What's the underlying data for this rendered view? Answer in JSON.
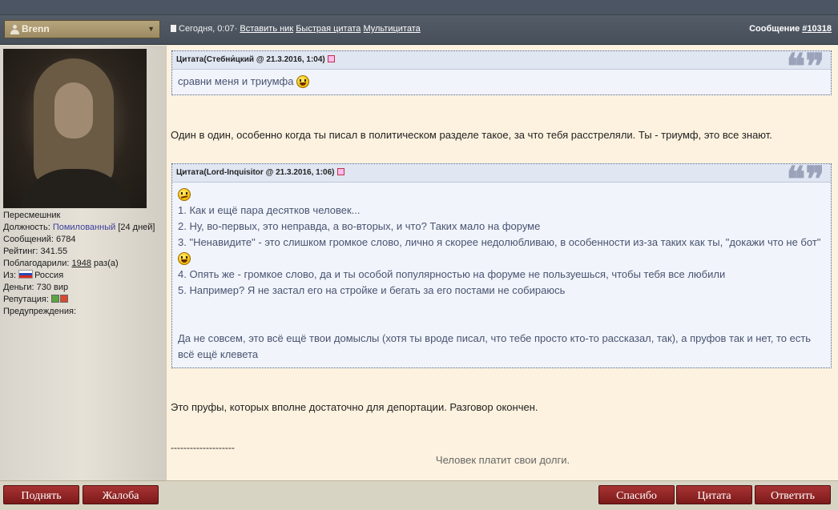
{
  "header": {
    "username": "Brenn",
    "post_time": "Сегодня, 0:07",
    "sep": "·",
    "insert_nick": "Вставить ник",
    "quick_quote": "Быстрая цитата",
    "multi_quote": "Мультицитата",
    "message_label": "Сообщение",
    "message_number": "#10318"
  },
  "profile": {
    "rank": "Пересмешник",
    "position_label": "Должность:",
    "position_value": "Помилованный",
    "position_days": "[24 дней]",
    "messages": "Сообщений: 6784",
    "rating": "Рейтинг: 341.55",
    "thanked_label": "Поблагодарили:",
    "thanked_count": "1948",
    "thanked_suffix": "раз(а)",
    "from_label": "Из:",
    "country": "Россия",
    "money": "Деньги: 730 вир",
    "reputation_label": "Репутация:",
    "warnings_label": "Предупреждения:",
    "flag_colors": [
      "#ffffff",
      "#2a47b8",
      "#d52b1e"
    ]
  },
  "post": {
    "quote1": {
      "header": "Цитата(Стебни́цкий @ 21.3.2016, 1:04)",
      "text": "сравни меня и триумфа"
    },
    "para1": "Один в один, особенно когда ты писал в политическом разделе такое, за что тебя расстреляли. Ты - триумф, это все знают.",
    "quote2": {
      "header": "Цитата(Lord-Inquisitor @ 21.3.2016, 1:06)",
      "lines": [
        "1. Как и ещё пара десятков человек...",
        "2. Ну, во-первых, это неправда, а во-вторых, и что? Таких мало на форуме",
        "3. \"Ненавидите\" - это слишком громкое слово, лично я скорее недолюбливаю, в особенности из-за таких как ты, \"докажи что не бот\"",
        "4. Опять же - громкое слово, да и ты особой популярностью на форуме не пользуешься, чтобы тебя все любили",
        "5. Например? Я не застал его на стройке и бегать за его постами не собираюсь"
      ],
      "reply_line1": "Да не совсем, это всё ещё твои домыслы (хотя ты вроде писал, что тебе просто кто-то рассказал, так), а пруфов так и нет, то есть",
      "reply_line2": "всё ещё клевета"
    },
    "para2": "Это пруфы, которых вполне достаточно для депортации. Разговор окончен.",
    "sig_divider": "--------------------",
    "signature": "Человек платит свои долги."
  },
  "buttons": {
    "up": "Поднять",
    "report": "Жалоба",
    "thanks": "Спасибо",
    "quote": "Цитата",
    "reply": "Ответить"
  },
  "colors": {
    "button_bg": "#8f2424",
    "quote_border": "#4b5e86",
    "content_bg": "#fdf2df"
  }
}
